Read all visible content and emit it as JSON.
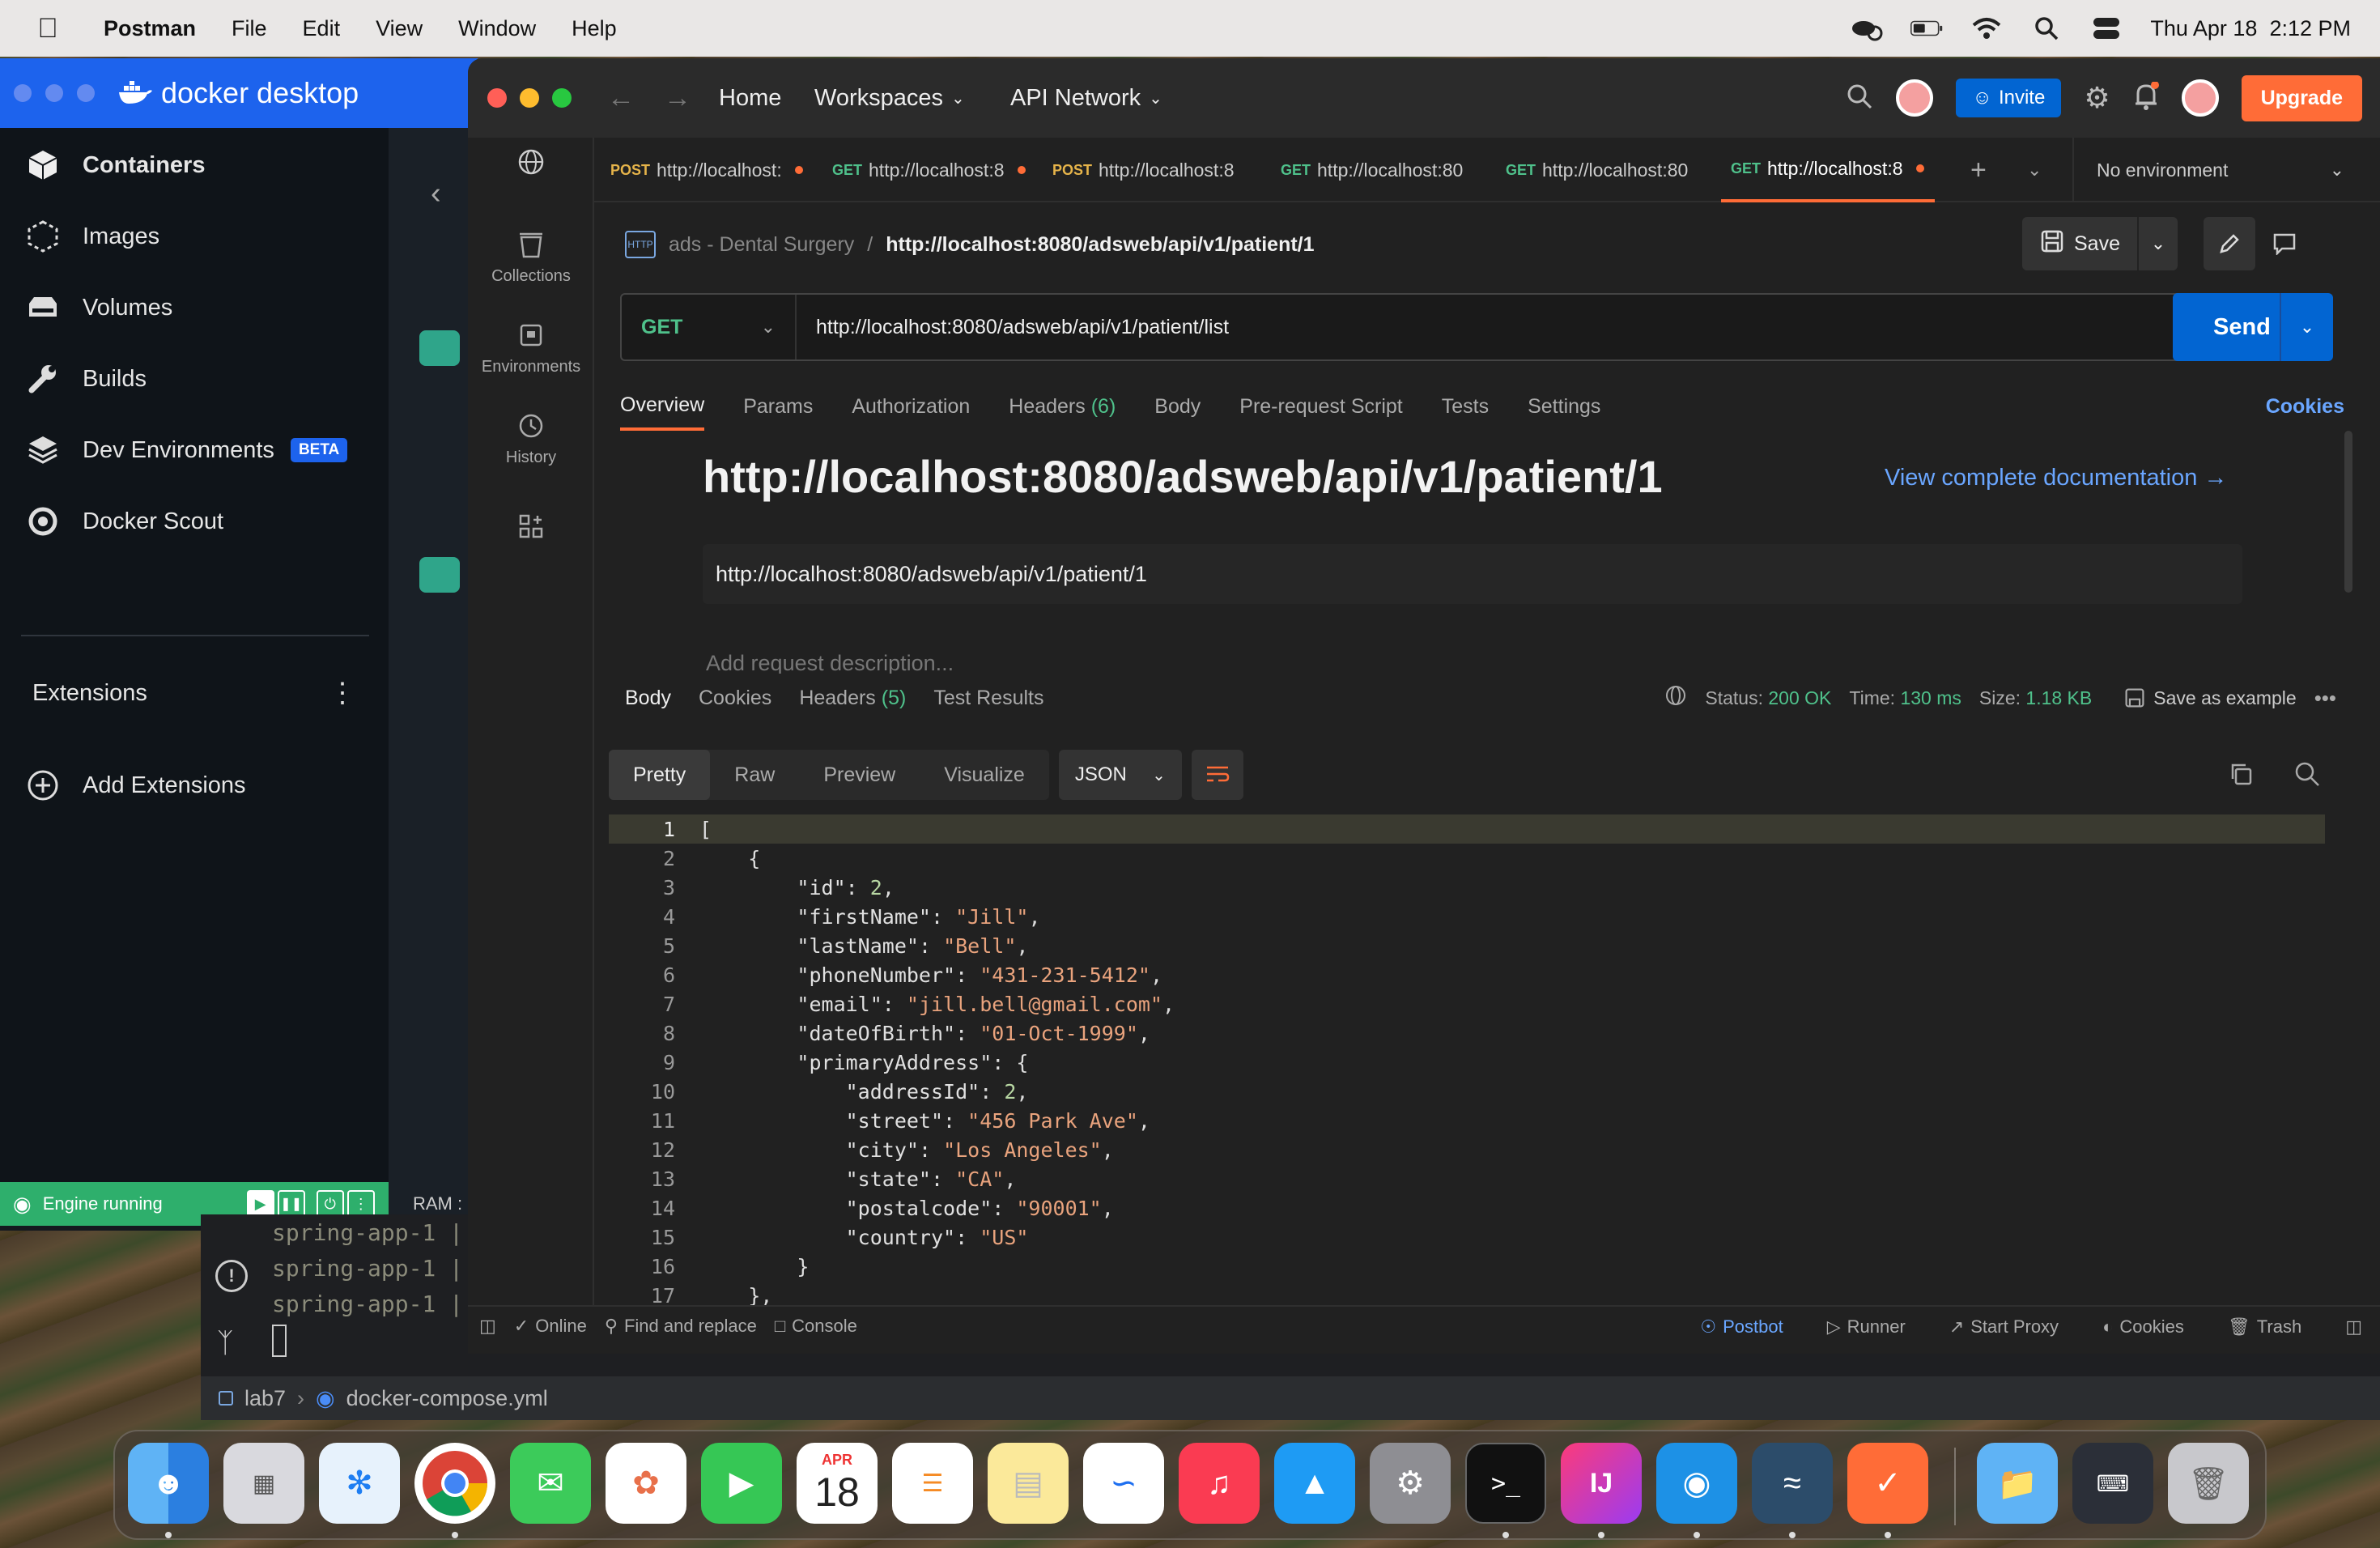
{
  "menubar": {
    "app_name": "Postman",
    "items": [
      "File",
      "Edit",
      "View",
      "Window",
      "Help"
    ],
    "datetime": "Thu Apr 18  2:12 PM"
  },
  "docker": {
    "logo_text": "docker desktop",
    "nav": [
      {
        "label": "Containers"
      },
      {
        "label": "Images"
      },
      {
        "label": "Volumes"
      },
      {
        "label": "Builds"
      },
      {
        "label": "Dev Environments",
        "badge": "BETA"
      },
      {
        "label": "Docker Scout"
      }
    ],
    "extensions_label": "Extensions",
    "add_extensions_label": "Add Extensions",
    "engine_status": "Engine running",
    "ram_label": "RAM :"
  },
  "terminal": {
    "lines": [
      "spring-app-1  |",
      "spring-app-1  |",
      "spring-app-1  |"
    ],
    "breadcrumb_folder": "lab7",
    "breadcrumb_file": "docker-compose.yml"
  },
  "postman": {
    "nav": {
      "home": "Home",
      "workspaces": "Workspaces",
      "api_network": "API Network"
    },
    "invite_label": "Invite",
    "upgrade_label": "Upgrade",
    "rail": [
      {
        "label": "Collections"
      },
      {
        "label": "Environments"
      },
      {
        "label": "History"
      }
    ],
    "tabs": [
      {
        "method": "POST",
        "url": "http://localhost:",
        "dirty": true
      },
      {
        "method": "GET",
        "url": "http://localhost:8",
        "dirty": true
      },
      {
        "method": "POST",
        "url": "http://localhost:8",
        "dirty": false
      },
      {
        "method": "GET",
        "url": "http://localhost:80",
        "dirty": false
      },
      {
        "method": "GET",
        "url": "http://localhost:80",
        "dirty": false
      },
      {
        "method": "GET",
        "url": "http://localhost:8",
        "dirty": true,
        "active": true
      }
    ],
    "environment": "No environment",
    "breadcrumb": {
      "collection": "ads - Dental Surgery",
      "separator": "/",
      "request": "http://localhost:8080/adsweb/api/v1/patient/1"
    },
    "save_label": "Save",
    "request": {
      "method": "GET",
      "url": "http://localhost:8080/adsweb/api/v1/patient/list",
      "send_label": "Send"
    },
    "request_tabs": [
      "Overview",
      "Params",
      "Authorization",
      "Headers",
      "Body",
      "Pre-request Script",
      "Tests",
      "Settings"
    ],
    "headers_count": "(6)",
    "cookies_label": "Cookies",
    "overview": {
      "title": "http://localhost:8080/adsweb/api/v1/patient/1",
      "doc_link": "View complete documentation →",
      "url": "http://localhost:8080/adsweb/api/v1/patient/1",
      "description_placeholder": "Add request description..."
    },
    "response": {
      "tabs": [
        "Body",
        "Cookies",
        "Headers",
        "Test Results"
      ],
      "headers_count": "(5)",
      "status_label": "Status:",
      "status": "200 OK",
      "time_label": "Time:",
      "time": "130 ms",
      "size_label": "Size:",
      "size": "1.18 KB",
      "save_example": "Save as example",
      "formats": [
        "Pretty",
        "Raw",
        "Preview",
        "Visualize"
      ],
      "language": "JSON"
    },
    "code_lines": [
      "[",
      "    {",
      "        \"id\": 2,",
      "        \"firstName\": \"Jill\",",
      "        \"lastName\": \"Bell\",",
      "        \"phoneNumber\": \"431-231-5412\",",
      "        \"email\": \"jill.bell@gmail.com\",",
      "        \"dateOfBirth\": \"01-Oct-1999\",",
      "        \"primaryAddress\": {",
      "            \"addressId\": 2,",
      "            \"street\": \"456 Park Ave\",",
      "            \"city\": \"Los Angeles\",",
      "            \"state\": \"CA\",",
      "            \"postalcode\": \"90001\",",
      "            \"country\": \"US\"",
      "        }",
      "    },"
    ],
    "status_bar": {
      "online": "Online",
      "find": "Find and replace",
      "console": "Console",
      "postbot": "Postbot",
      "runner": "Runner",
      "proxy": "Start Proxy",
      "cookies": "Cookies",
      "trash": "Trash"
    }
  },
  "dock": {
    "calendar_month": "APR",
    "calendar_day": "18",
    "apps": [
      "finder-icon",
      "launchpad-icon",
      "safari-icon",
      "chrome-icon",
      "messages-icon",
      "photos-icon",
      "facetime-icon",
      "calendar-icon",
      "reminders-icon",
      "notes-icon",
      "freeform-icon",
      "music-icon",
      "app-store-icon",
      "system-settings-icon",
      "terminal-icon",
      "intellij-icon",
      "docker-icon",
      "mysql-workbench-icon",
      "postman-icon",
      "folder-icon",
      "keyboard-icon",
      "trash-icon"
    ]
  }
}
